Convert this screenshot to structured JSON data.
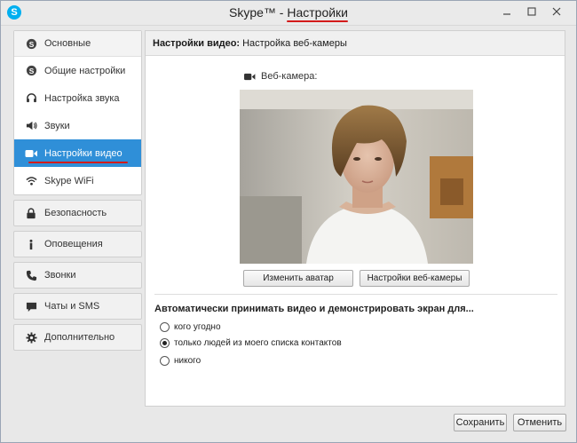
{
  "window": {
    "title_prefix": "Skype™ - ",
    "title_highlight": "Настройки",
    "app_icon": "S",
    "controls": [
      "minimize-icon",
      "maximize-icon",
      "close-icon"
    ]
  },
  "sidebar": {
    "group": {
      "label": "Основные",
      "icon": "skype-icon"
    },
    "sub_items": [
      {
        "label": "Общие настройки",
        "icon": "skype-icon",
        "active": false
      },
      {
        "label": "Настройка звука",
        "icon": "headset-icon",
        "active": false
      },
      {
        "label": "Звуки",
        "icon": "speaker-icon",
        "active": false
      },
      {
        "label": "Настройки видео",
        "icon": "video-camera-icon",
        "active": true
      },
      {
        "label": "Skype WiFi",
        "icon": "wifi-icon",
        "active": false
      }
    ],
    "items": [
      {
        "label": "Безопасность",
        "icon": "lock-icon"
      },
      {
        "label": "Оповещения",
        "icon": "info-icon"
      },
      {
        "label": "Звонки",
        "icon": "phone-icon"
      },
      {
        "label": "Чаты и SMS",
        "icon": "chat-icon"
      },
      {
        "label": "Дополнительно",
        "icon": "gear-icon"
      }
    ]
  },
  "main": {
    "header_bold": "Настройки видео:",
    "header_text": "Настройка веб-камеры",
    "webcam_label": "Веб-камера:",
    "change_avatar_button": "Изменить аватар",
    "webcam_settings_button": "Настройки веб-камеры",
    "auto_accept_title": "Автоматически принимать видео и демонстрировать экран для...",
    "options": [
      {
        "label": "кого угодно",
        "checked": false
      },
      {
        "label": "только людей из моего списка контактов",
        "checked": true
      },
      {
        "label": "никого",
        "checked": false
      }
    ]
  },
  "footer": {
    "save_button": "Сохранить",
    "cancel_button": "Отменить"
  },
  "colors": {
    "accent": "#2f8fd8",
    "annotation_red": "#d31a1a",
    "skype_blue": "#00aff0"
  }
}
